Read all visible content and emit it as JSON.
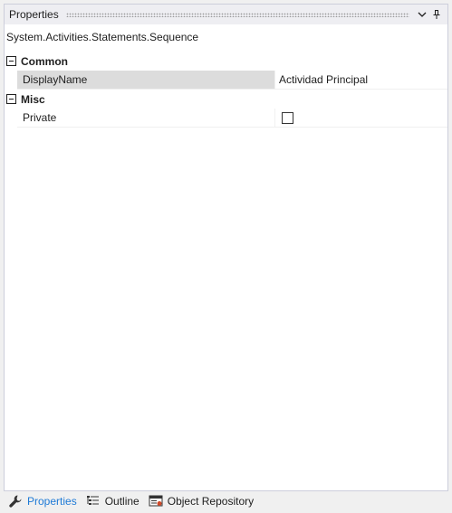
{
  "panel": {
    "title": "Properties"
  },
  "type_name": "System.Activities.Statements.Sequence",
  "categories": [
    {
      "label": "Common",
      "properties": [
        {
          "name": "DisplayName",
          "value": "Actividad Principal"
        }
      ]
    },
    {
      "label": "Misc",
      "properties": [
        {
          "name": "Private",
          "checked": false
        }
      ]
    }
  ],
  "tabs": [
    {
      "label": "Properties",
      "icon": "wrench-icon",
      "active": true
    },
    {
      "label": "Outline",
      "icon": "outline-list-icon",
      "active": false
    },
    {
      "label": "Object Repository",
      "icon": "object-repository-icon",
      "active": false
    }
  ],
  "colors": {
    "accent": "#1e7ad6",
    "selected_row": "#dcdcdc",
    "titlebar": "#eeeef2"
  }
}
